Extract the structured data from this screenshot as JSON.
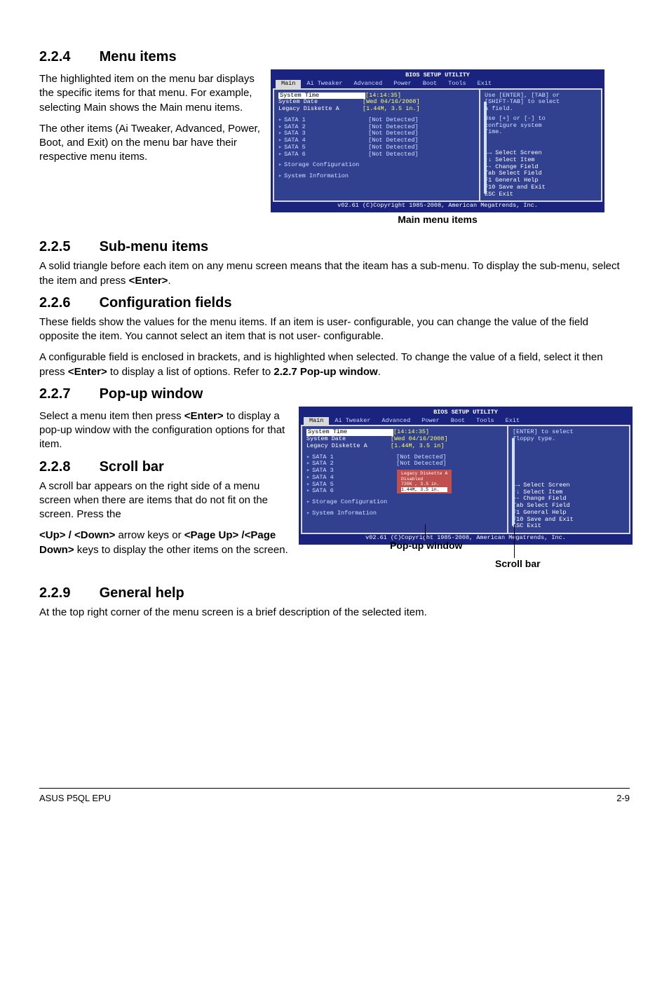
{
  "sections": {
    "s4": {
      "num": "2.2.4",
      "title": "Menu items"
    },
    "s5": {
      "num": "2.2.5",
      "title": "Sub-menu items"
    },
    "s6": {
      "num": "2.2.6",
      "title": "Configuration fields"
    },
    "s7": {
      "num": "2.2.7",
      "title": "Pop-up window"
    },
    "s8": {
      "num": "2.2.8",
      "title": "Scroll bar"
    },
    "s9": {
      "num": "2.2.9",
      "title": "General help"
    }
  },
  "paras": {
    "p4a": "The highlighted item on the menu bar displays the specific items for that menu. For example, selecting Main shows the Main menu items.",
    "p4b": "The other items (Ai Tweaker, Advanced, Power, Boot, and Exit) on the menu bar have their respective menu items.",
    "p5": "A solid triangle before each item on any menu screen means that the iteam has a sub-menu. To display the sub-menu, select the item and press <Enter>.",
    "p6a": "These fields show the values for the menu items. If an item is user- configurable, you can change the value of the field opposite the item. You cannot select an item that is not user- configurable.",
    "p6b": "A configurable field is enclosed in brackets, and is highlighted when selected. To change the value of a field, select it then press <Enter> to display a list of options. Refer to 2.2.7 Pop-up window.",
    "p7": "Select a menu item then press <Enter> to display a pop-up window with the configuration options for that item.",
    "p8a": "A scroll bar appears on the right side of a menu screen when there are items that do not fit on the screen. Press the",
    "p8b": "<Up> / <Down> arrow keys or <Page Up> /<Page Down> keys to display the other items on the screen.",
    "p9": "At the top right corner of the menu screen is a brief description of the selected item."
  },
  "bios": {
    "title": "BIOS SETUP UTILITY",
    "menu": [
      "Main",
      "Ai Tweaker",
      "Advanced",
      "Power",
      "Boot",
      "Tools",
      "Exit"
    ],
    "footer": "v02.61 (C)Copyright 1985-2008, American Megatrends, Inc.",
    "rows1": {
      "r1k": "System Time",
      "r1v": "[14:14:35]",
      "r2k": "System Date",
      "r2v": "[Wed 04/16/2008]",
      "r3k": "Legacy Diskette A",
      "r3v": "[1.44M, 3.5 in.]",
      "s1": "SATA 1",
      "s1v": "[Not Detected]",
      "s2": "SATA 2",
      "s2v": "[Not Detected]",
      "s3": "SATA 3",
      "s3v": "[Not Detected]",
      "s4": "SATA 4",
      "s4v": "[Not Detected]",
      "s5": "SATA 5",
      "s5v": "[Not Detected]",
      "s6": "SATA 6",
      "s6v": "[Not Detected]",
      "sc": "Storage Configuration",
      "si": "System Information"
    },
    "help1": {
      "h1": "Use [ENTER], [TAB] or",
      "h2": "[SHIFT-TAB] to select",
      "h3": "a field.",
      "h4": "Use [+] or [-] to",
      "h5": "configure system",
      "h6": "Time.",
      "n1": "←→   Select Screen",
      "n2": "↑↓   Select Item",
      "n3": "+-   Change Field",
      "n4": "Tab  Select Field",
      "n5": "F1   General Help",
      "n6": "F10  Save and Exit",
      "n7": "ESC  Exit"
    },
    "help2": {
      "h1": "[ENTER] to select",
      "h2": "floppy type."
    },
    "rows2": {
      "r3v": "[1.44M, 3.5 in]"
    },
    "popup": {
      "t": "Legacy Diskette A",
      "o1": "Disabled",
      "o2": "720K , 3.5 in.",
      "o3": "1.44M, 3.5 in."
    }
  },
  "captions": {
    "c1": "Main menu items",
    "c2": "Pop-up window",
    "c3": "Scroll bar"
  },
  "footer": {
    "left": "ASUS P5QL EPU",
    "right": "2-9"
  }
}
